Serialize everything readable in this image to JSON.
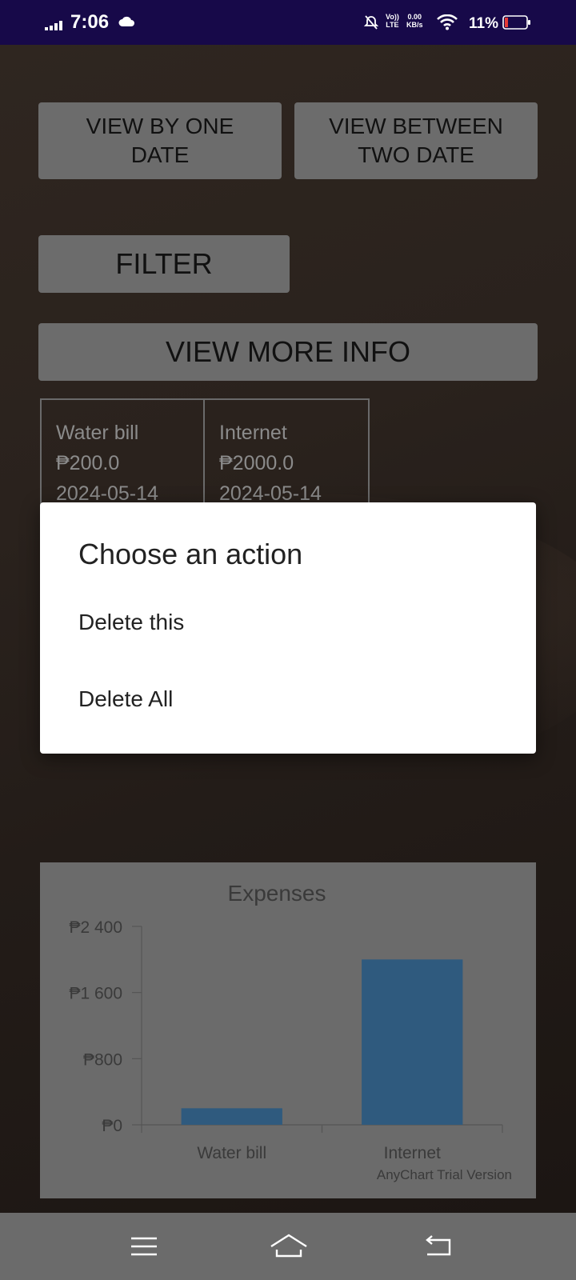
{
  "status_bar": {
    "time": "7:06",
    "volte_line1": "Vo))",
    "volte_line2": "LTE",
    "net_speed_value": "0.00",
    "net_speed_unit": "KB/s",
    "battery_percent": "11%",
    "battery_color": "#e53935",
    "icons": [
      "signal-icon",
      "cloud-icon",
      "notifications-off-icon",
      "wifi-icon",
      "battery-icon"
    ]
  },
  "buttons": {
    "view_one_date": "VIEW BY ONE DATE",
    "view_between": "VIEW BETWEEN TWO DATE",
    "filter": "FILTER",
    "view_more": "VIEW MORE INFO"
  },
  "expenses": [
    {
      "name": "Water bill",
      "amount": "₱200.0",
      "date": "2024-05-14"
    },
    {
      "name": "Internet",
      "amount": "₱2000.0",
      "date": "2024-05-14"
    }
  ],
  "dialog": {
    "title": "Choose an action",
    "items": [
      "Delete this",
      "Delete All"
    ]
  },
  "chart_data": {
    "type": "bar",
    "title": "Expenses",
    "categories": [
      "Water bill",
      "Internet"
    ],
    "values": [
      200,
      2000
    ],
    "ylim": [
      0,
      2400
    ],
    "yticks": [
      0,
      800,
      1600,
      2400
    ],
    "ytick_labels": [
      "₱0",
      "₱800",
      "₱1 600",
      "₱2 400"
    ],
    "bar_color": "#2f5a7e",
    "credit": "AnyChart Trial Version"
  },
  "nav_bar": {
    "icons": [
      "menu-icon",
      "home-icon",
      "back-icon"
    ]
  }
}
